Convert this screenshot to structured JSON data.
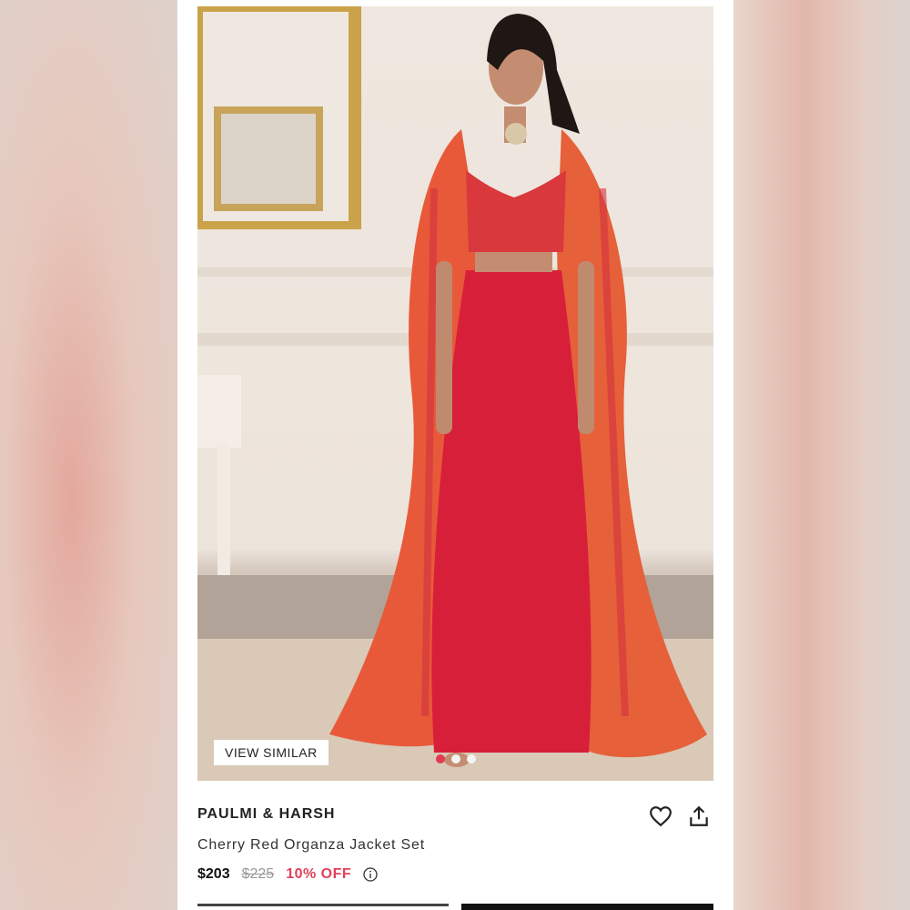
{
  "product": {
    "brand": "PAULMI & HARSH",
    "title": "Cherry Red Organza Jacket Set",
    "price": "$203",
    "mrp": "$225",
    "discount": "10% OFF"
  },
  "gallery": {
    "view_similar_label": "VIEW SIMILAR",
    "dots": 3,
    "active_dot": 1
  },
  "icons": {
    "wishlist": "heart-icon",
    "share": "share-icon",
    "info": "info-icon"
  },
  "colors": {
    "discount": "#e1405b",
    "active_dot": "#e23b55",
    "outfit_red": "#d81f3a",
    "cape_orange": "#e8593a"
  }
}
